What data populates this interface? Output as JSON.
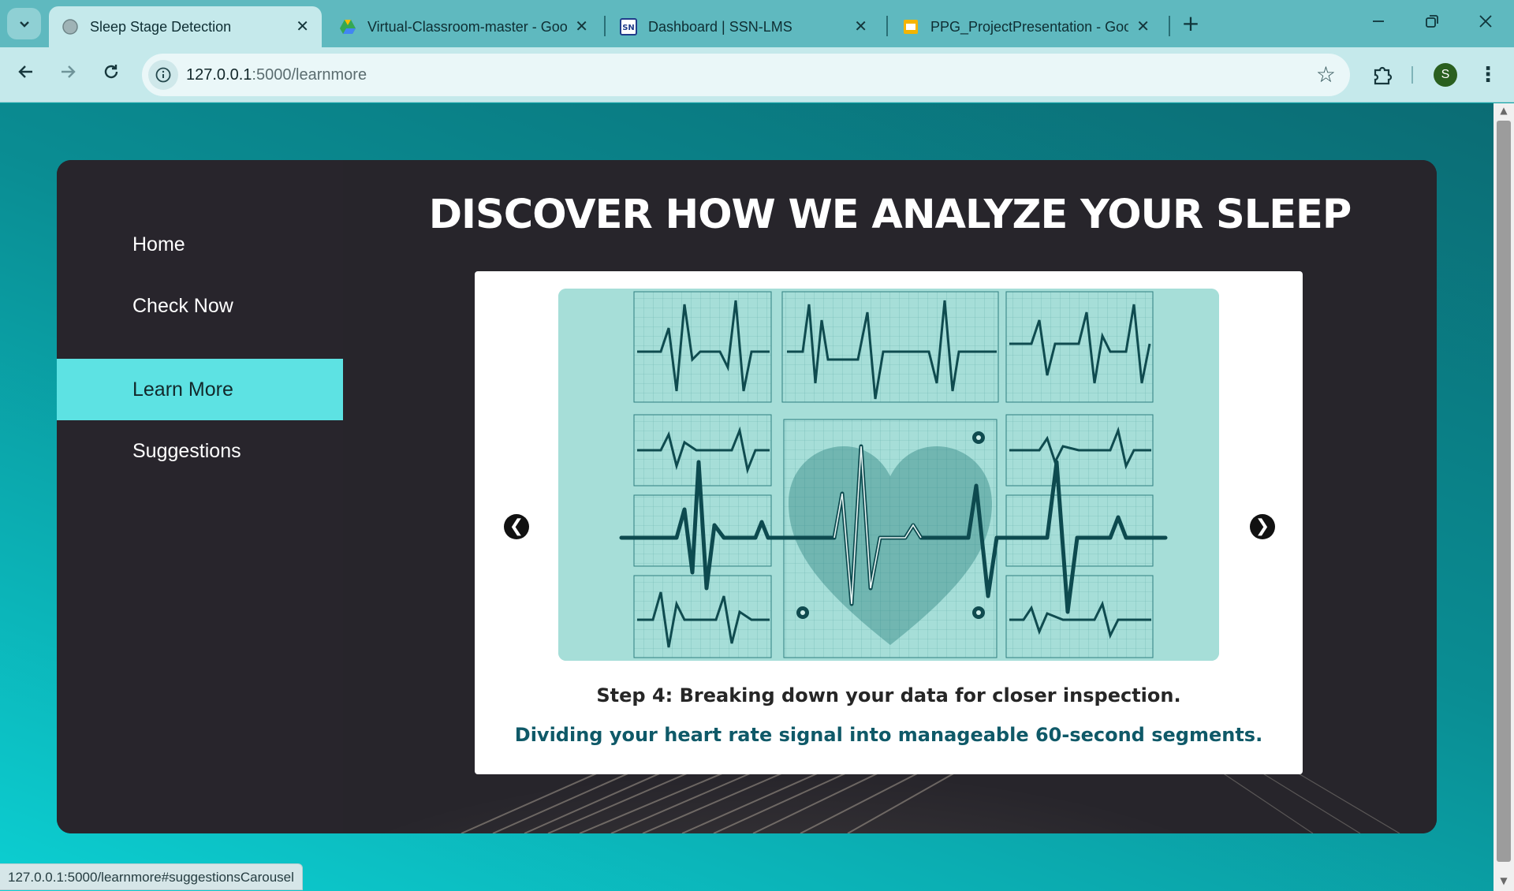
{
  "browser": {
    "tabs": [
      {
        "title": "Sleep Stage Detection",
        "icon": "globe-icon",
        "active": true
      },
      {
        "title": "Virtual-Classroom-master - Google Drive",
        "icon": "google-drive-icon",
        "active": false
      },
      {
        "title": "Dashboard | SSN-LMS",
        "icon": "ssn-icon",
        "active": false
      },
      {
        "title": "PPG_ProjectPresentation - Google Slides",
        "icon": "google-slides-icon",
        "active": false
      }
    ],
    "new_tab_label": "+",
    "url_host": "127.0.0.1",
    "url_path": ":5000/learnmore",
    "profile_initial": "S",
    "window_controls": {
      "minimize": "—",
      "restore": "❐",
      "close": "✕"
    },
    "accent_color": "#5fb9bf"
  },
  "sidebar": {
    "items": [
      {
        "label": "Home",
        "active": false
      },
      {
        "label": "Check Now",
        "active": false
      },
      {
        "label": "Learn More",
        "active": true
      },
      {
        "label": "Suggestions",
        "active": false
      }
    ],
    "active_color": "#5de2e3"
  },
  "main": {
    "title": "DISCOVER HOW WE ANALYZE YOUR SLEEP",
    "carousel": {
      "image_icon": "heart-ecg-illustration",
      "prev_label": "❮",
      "next_label": "❯",
      "step_title": "Step 4: Breaking down your data for closer inspection.",
      "step_description": "Dividing your heart rate signal into manageable 60-second segments."
    }
  },
  "status_bar": {
    "text": "127.0.0.1:5000/learnmore#suggestionsCarousel"
  }
}
